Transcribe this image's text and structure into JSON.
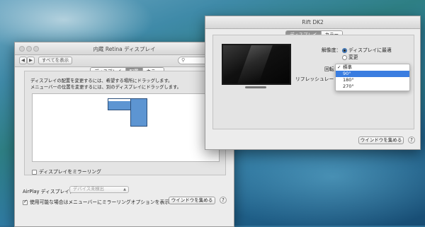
{
  "left_window": {
    "title": "内蔵 Retina ディスプレイ",
    "nav_back": "◀",
    "nav_fwd": "▶",
    "show_all": "すべてを表示",
    "search_placeholder": "",
    "tabs": [
      {
        "label": "ディスプレイ"
      },
      {
        "label": "配置"
      },
      {
        "label": "カラー"
      }
    ],
    "desc_line1": "ディスプレイの配置を変更するには、希望する場所にドラッグします。",
    "desc_line2": "メニューバーの位置を変更するには、別のディスプレイにドラッグします。",
    "mirror_label": "ディスプレイをミラーリング",
    "airplay_label": "AirPlay ディスプレイ：",
    "airplay_value": "デバイス未検出",
    "show_mirroring_label": "使用可能な場合はメニューバーにミラーリングオプションを表示",
    "gather_button": "ウインドウを集める",
    "help": "?"
  },
  "right_window": {
    "title": "Rift DK2",
    "tabs": [
      {
        "label": "ディスプレイ"
      },
      {
        "label": "カラー"
      }
    ],
    "resolution_label": "解像度：",
    "resolution_options": [
      {
        "label": "ディスプレイに最適"
      },
      {
        "label": "変更"
      }
    ],
    "rotation_label": "回転：",
    "refresh_label": "リフレッシュレート",
    "rotation_menu": [
      {
        "label": "標準",
        "checked": "✓"
      },
      {
        "label": "90°",
        "checked": ""
      },
      {
        "label": "180°",
        "checked": ""
      },
      {
        "label": "270°",
        "checked": ""
      }
    ],
    "gather_button": "ウインドウを集める",
    "help": "?"
  },
  "colors": {
    "accent": "#3a7de0",
    "display_block": "#5d95d2"
  }
}
